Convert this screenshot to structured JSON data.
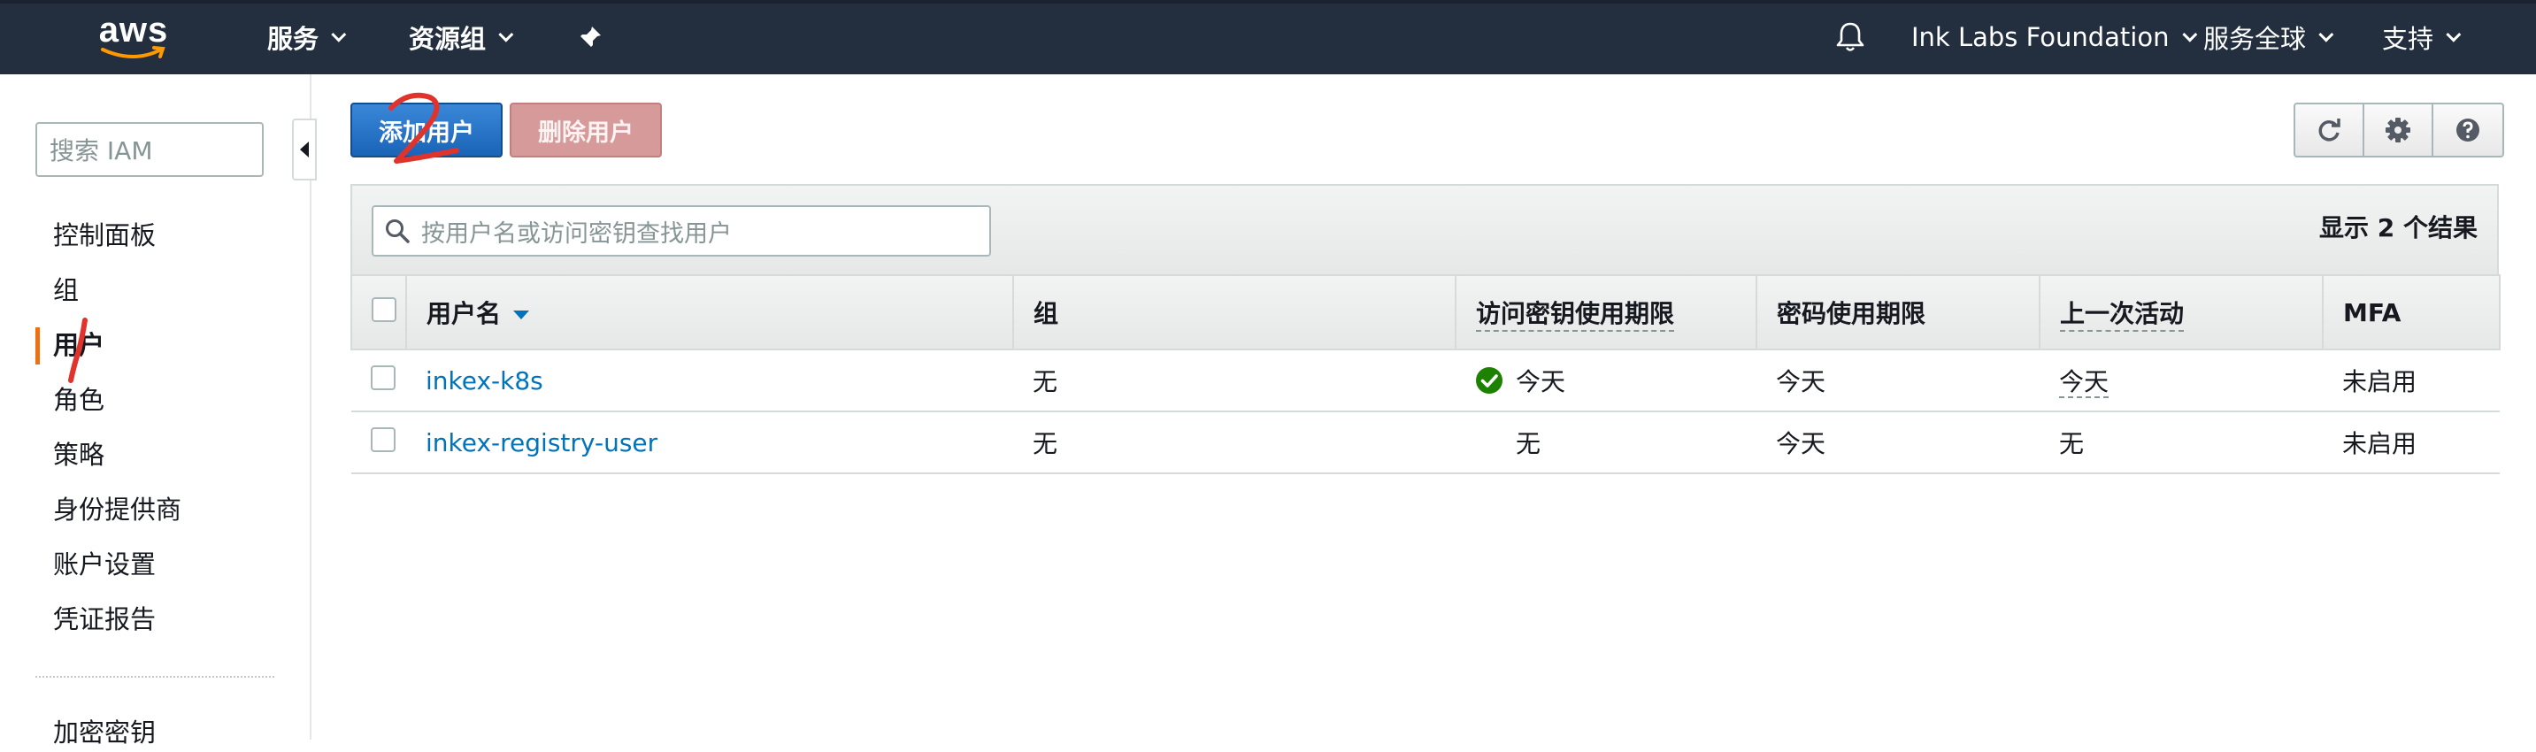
{
  "header": {
    "logo_text": "aws",
    "services_label": "服务",
    "resource_groups_label": "资源组",
    "account_label": "Ink Labs Foundation",
    "region_label": "服务全球",
    "support_label": "支持"
  },
  "sidebar": {
    "search_placeholder": "搜索 IAM",
    "items": [
      {
        "label": "控制面板"
      },
      {
        "label": "组"
      },
      {
        "label": "用户"
      },
      {
        "label": "角色"
      },
      {
        "label": "策略"
      },
      {
        "label": "身份提供商"
      },
      {
        "label": "账户设置"
      },
      {
        "label": "凭证报告"
      },
      {
        "label": "加密密钥"
      }
    ],
    "active_item": "用户"
  },
  "toolbar": {
    "add_user_label": "添加用户",
    "delete_user_label": "删除用户"
  },
  "filter": {
    "placeholder": "按用户名或访问密钥查找用户",
    "result_count": "显示 2 个结果"
  },
  "table": {
    "columns": [
      "用户名",
      "组",
      "访问密钥使用期限",
      "密码使用期限",
      "上一次活动",
      "MFA"
    ],
    "rows": [
      {
        "username": "inkex-k8s",
        "groups": "无",
        "access_key_age": "今天",
        "password_age": "今天",
        "last_activity": "今天",
        "mfa": "未启用"
      },
      {
        "username": "inkex-registry-user",
        "groups": "无",
        "access_key_age": "无",
        "password_age": "今天",
        "last_activity": "无",
        "mfa": "未启用"
      }
    ]
  },
  "colors": {
    "nav_bg": "#232f3e",
    "accent": "#ec7211",
    "primary": "#1a64b8",
    "link": "#0073bb",
    "annotation": "#e0332b",
    "ok": "#1d8102"
  },
  "icons": [
    "bell-icon",
    "pin-icon",
    "refresh-icon",
    "gear-icon",
    "help-icon",
    "search-icon",
    "check-circle-icon"
  ]
}
